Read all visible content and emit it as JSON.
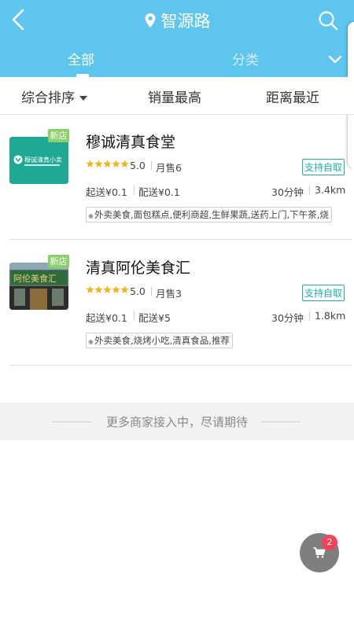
{
  "header": {
    "location": "智源路",
    "tabs": [
      {
        "label": "全部",
        "active": true
      },
      {
        "label": "分类",
        "active": false
      }
    ],
    "accent_color": "#5ec5ef"
  },
  "sort": {
    "items": [
      "综合排序",
      "销量最高",
      "距离最近"
    ]
  },
  "stores": [
    {
      "name": "穆诚清真食堂",
      "badge": "新店",
      "thumb_text": "穆诚清真小卖",
      "rating": "5.0",
      "rating_stars": 5,
      "sold": "月售6",
      "pickup": "支持自取",
      "min_order": "起送¥0.1",
      "delivery_fee": "配送¥0.1",
      "time": "30分钟",
      "distance": "3.4km",
      "tags": "外卖美食,面包糕点,便利商超,生鲜果蔬,送药上门,下午茶,烧"
    },
    {
      "name": "清真阿伦美食汇",
      "badge": "新店",
      "thumb_text": "阿伦美食汇",
      "rating": "5.0",
      "rating_stars": 5,
      "sold": "月售3",
      "pickup": "支持自取",
      "min_order": "起送¥0.1",
      "delivery_fee": "配送¥5",
      "time": "30分钟",
      "distance": "1.8km",
      "tags": "外卖美食,烧烤小吃,清真食品,推荐"
    }
  ],
  "footer": {
    "more_text": "更多商家接入中，尽请期待"
  },
  "cart": {
    "count": "2",
    "icon": "cart-icon",
    "badge_color": "#f2435a"
  }
}
